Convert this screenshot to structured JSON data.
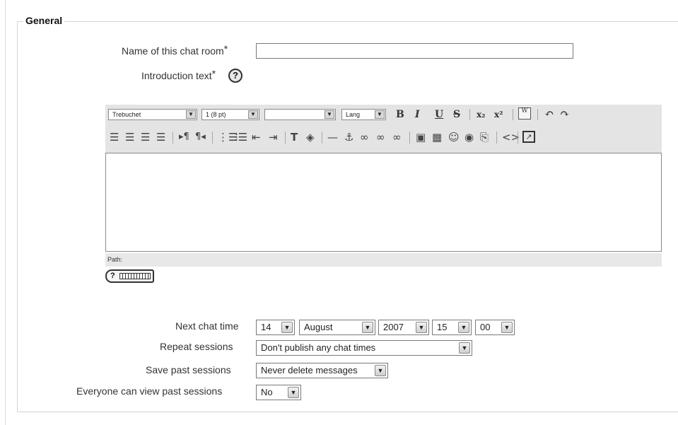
{
  "section": {
    "legend": "General"
  },
  "fields": {
    "name_label": "Name of this chat room",
    "name_required": "*",
    "name_value": "",
    "intro_label": "Introduction text",
    "intro_required": "*",
    "help_glyph": "?"
  },
  "editor": {
    "font_family": "Trebuchet",
    "font_size": "1 (8 pt)",
    "style_value": "",
    "lang": "Lang",
    "format_buttons": [
      "B",
      "I",
      "U",
      "S"
    ],
    "sub": "x₂",
    "sup": "x²",
    "undo": "↶",
    "redo": "↷",
    "path_label": "Path:",
    "toolbar_icons_row1": [
      "bold-icon",
      "italic-icon",
      "underline-icon",
      "strikethrough-icon",
      "subscript-icon",
      "superscript-icon",
      "paste-word-icon",
      "undo-icon",
      "redo-icon"
    ],
    "toolbar_icons_row2": [
      "align-left-icon",
      "align-center-icon",
      "align-right-icon",
      "justify-icon",
      "ltr-icon",
      "rtl-icon",
      "ordered-list-icon",
      "unordered-list-icon",
      "outdent-icon",
      "indent-icon",
      "text-color-icon",
      "bg-color-icon",
      "horizontal-rule-icon",
      "anchor-icon",
      "link-icon",
      "unlink-icon",
      "nolink-icon",
      "image-icon",
      "table-icon",
      "smiley-icon",
      "search-icon",
      "clean-html-icon",
      "html-source-icon",
      "fullscreen-icon"
    ]
  },
  "keyboard_help": {
    "glyph": "?"
  },
  "schedule": {
    "next_chat_label": "Next chat time",
    "day": "14",
    "month": "August",
    "year": "2007",
    "hour": "15",
    "minute": "00",
    "repeat_label": "Repeat sessions",
    "repeat_value": "Don't publish any chat times",
    "save_label": "Save past sessions",
    "save_value": "Never delete messages",
    "view_label": "Everyone can view past sessions",
    "view_value": "No"
  }
}
